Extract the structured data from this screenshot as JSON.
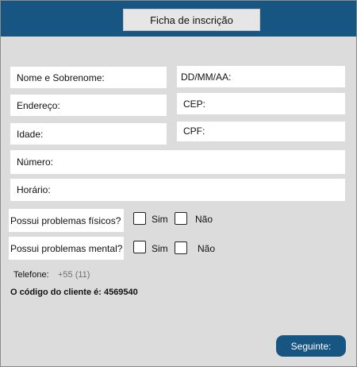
{
  "header": {
    "title": "Ficha de inscrição"
  },
  "form": {
    "fields": {
      "name": "Nome e Sobrenome:",
      "birthdate": "DD/MM/AA:",
      "address": "Endereço:",
      "cep": "CEP:",
      "age": "Idade:",
      "cpf": "CPF:",
      "number": "Número:",
      "time": "Horário:"
    },
    "questions": [
      {
        "label": "Possui problemas físicos?",
        "yes_label": "Sim",
        "no_label": "Não",
        "yes_checked": false,
        "no_checked": false
      },
      {
        "label": "Possui problemas mental?",
        "yes_label": "Sim",
        "no_label": "Não",
        "yes_checked": false,
        "no_checked": false
      }
    ],
    "phone": {
      "label": "Telefone:",
      "value": "+55 (11)"
    },
    "client_code": "O código do cliente é: 4569540"
  },
  "actions": {
    "next_label": "Seguinte:"
  },
  "colors": {
    "header": "#175582",
    "background": "#dcdcdc",
    "button": "#175582"
  }
}
